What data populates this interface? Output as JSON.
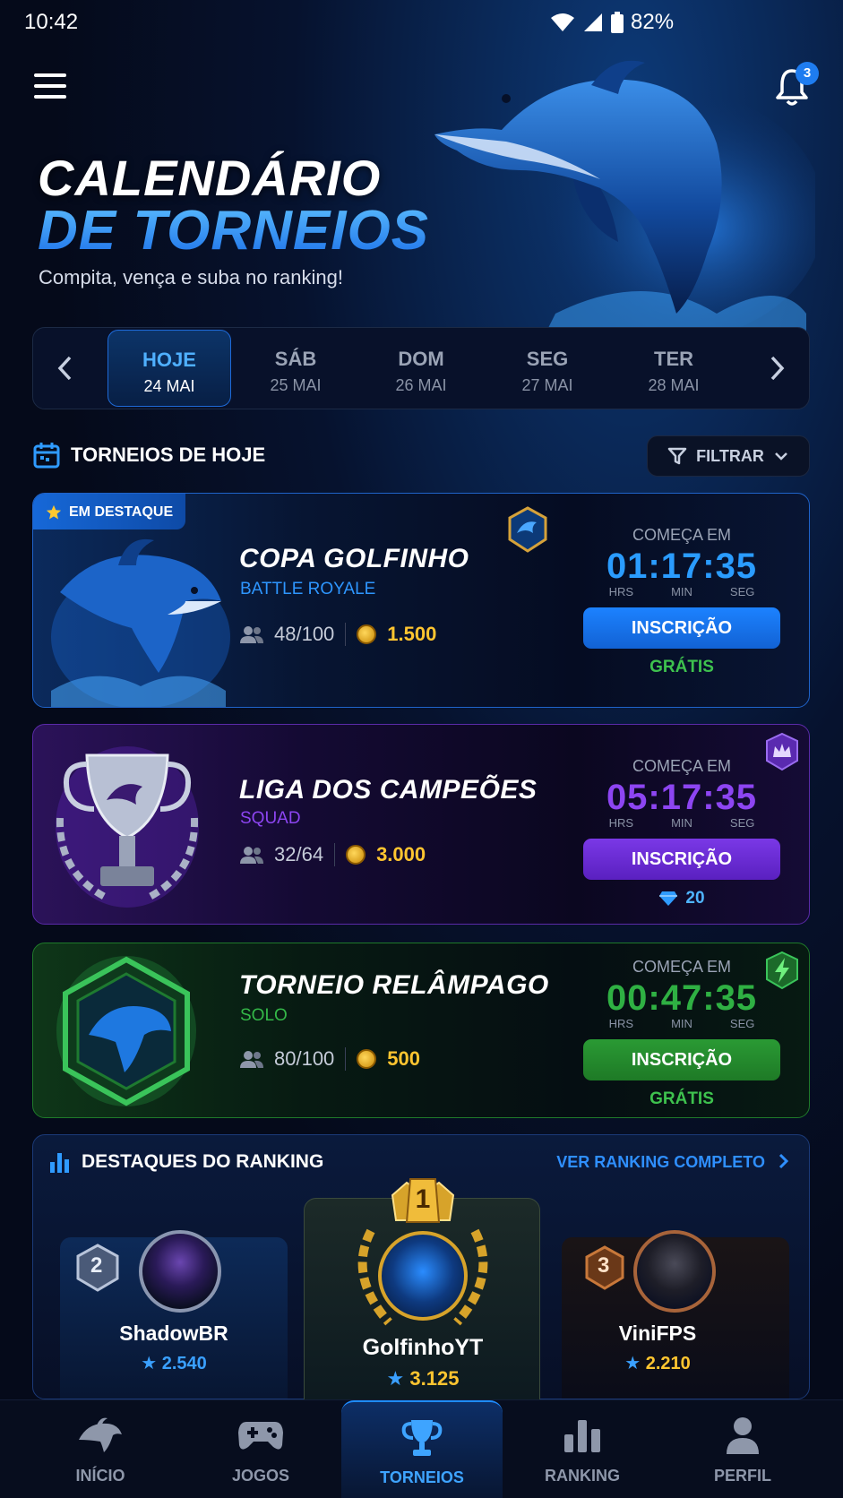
{
  "status": {
    "time": "10:42",
    "battery": "82%"
  },
  "header": {
    "notification_count": "3"
  },
  "hero": {
    "title_line1": "CALENDÁRIO",
    "title_line2": "DE TORNEIOS",
    "subtitle": "Compita, vença e suba no ranking!"
  },
  "dates": [
    {
      "day": "HOJE",
      "date": "24 MAI",
      "active": true
    },
    {
      "day": "SÁB",
      "date": "25 MAI"
    },
    {
      "day": "DOM",
      "date": "26 MAI"
    },
    {
      "day": "SEG",
      "date": "27 MAI"
    },
    {
      "day": "TER",
      "date": "28 MAI"
    }
  ],
  "section": {
    "title": "TORNEIOS DE HOJE",
    "filter": "FILTRAR"
  },
  "tournaments": [
    {
      "badge": "EM DESTAQUE",
      "name": "COPA GOLFINHO",
      "mode": "BATTLE ROYALE",
      "players": "48/100",
      "prize": "1.500",
      "starts_label": "COMEÇA EM",
      "timer": "01:17:35",
      "units": [
        "HRS",
        "MIN",
        "SEG"
      ],
      "button": "INSCRIÇÃO",
      "price": "GRÁTIS",
      "accent": "#1a8cff",
      "button_color": "#1670e8"
    },
    {
      "name": "LIGA DOS CAMPEÕES",
      "mode": "SQUAD",
      "players": "32/64",
      "prize": "3.000",
      "starts_label": "COMEÇA EM",
      "timer": "05:17:35",
      "units": [
        "HRS",
        "MIN",
        "SEG"
      ],
      "button": "INSCRIÇÃO",
      "price": "20",
      "accent": "#8b3cf0",
      "button_color": "#6a2ad0"
    },
    {
      "name": "TORNEIO RELÂMPAGO",
      "mode": "SOLO",
      "players": "80/100",
      "prize": "500",
      "starts_label": "COMEÇA EM",
      "timer": "00:47:35",
      "units": [
        "HRS",
        "MIN",
        "SEG"
      ],
      "button": "INSCRIÇÃO",
      "price": "GRÁTIS",
      "accent": "#2bb34a",
      "button_color": "#238a2c"
    }
  ],
  "ranking": {
    "title": "DESTAQUES DO RANKING",
    "link": "VER RANKING COMPLETO",
    "podium": [
      {
        "place": "2",
        "name": "ShadowBR",
        "score": "2.540"
      },
      {
        "place": "1",
        "name": "GolfinhoYT",
        "score": "3.125"
      },
      {
        "place": "3",
        "name": "ViniFPS",
        "score": "2.210"
      }
    ]
  },
  "nav": [
    {
      "label": "INÍCIO",
      "icon": "dolphin-icon"
    },
    {
      "label": "JOGOS",
      "icon": "gamepad-icon"
    },
    {
      "label": "TORNEIOS",
      "icon": "trophy-icon",
      "active": true
    },
    {
      "label": "RANKING",
      "icon": "bar-chart-icon"
    },
    {
      "label": "PERFIL",
      "icon": "user-icon"
    }
  ]
}
